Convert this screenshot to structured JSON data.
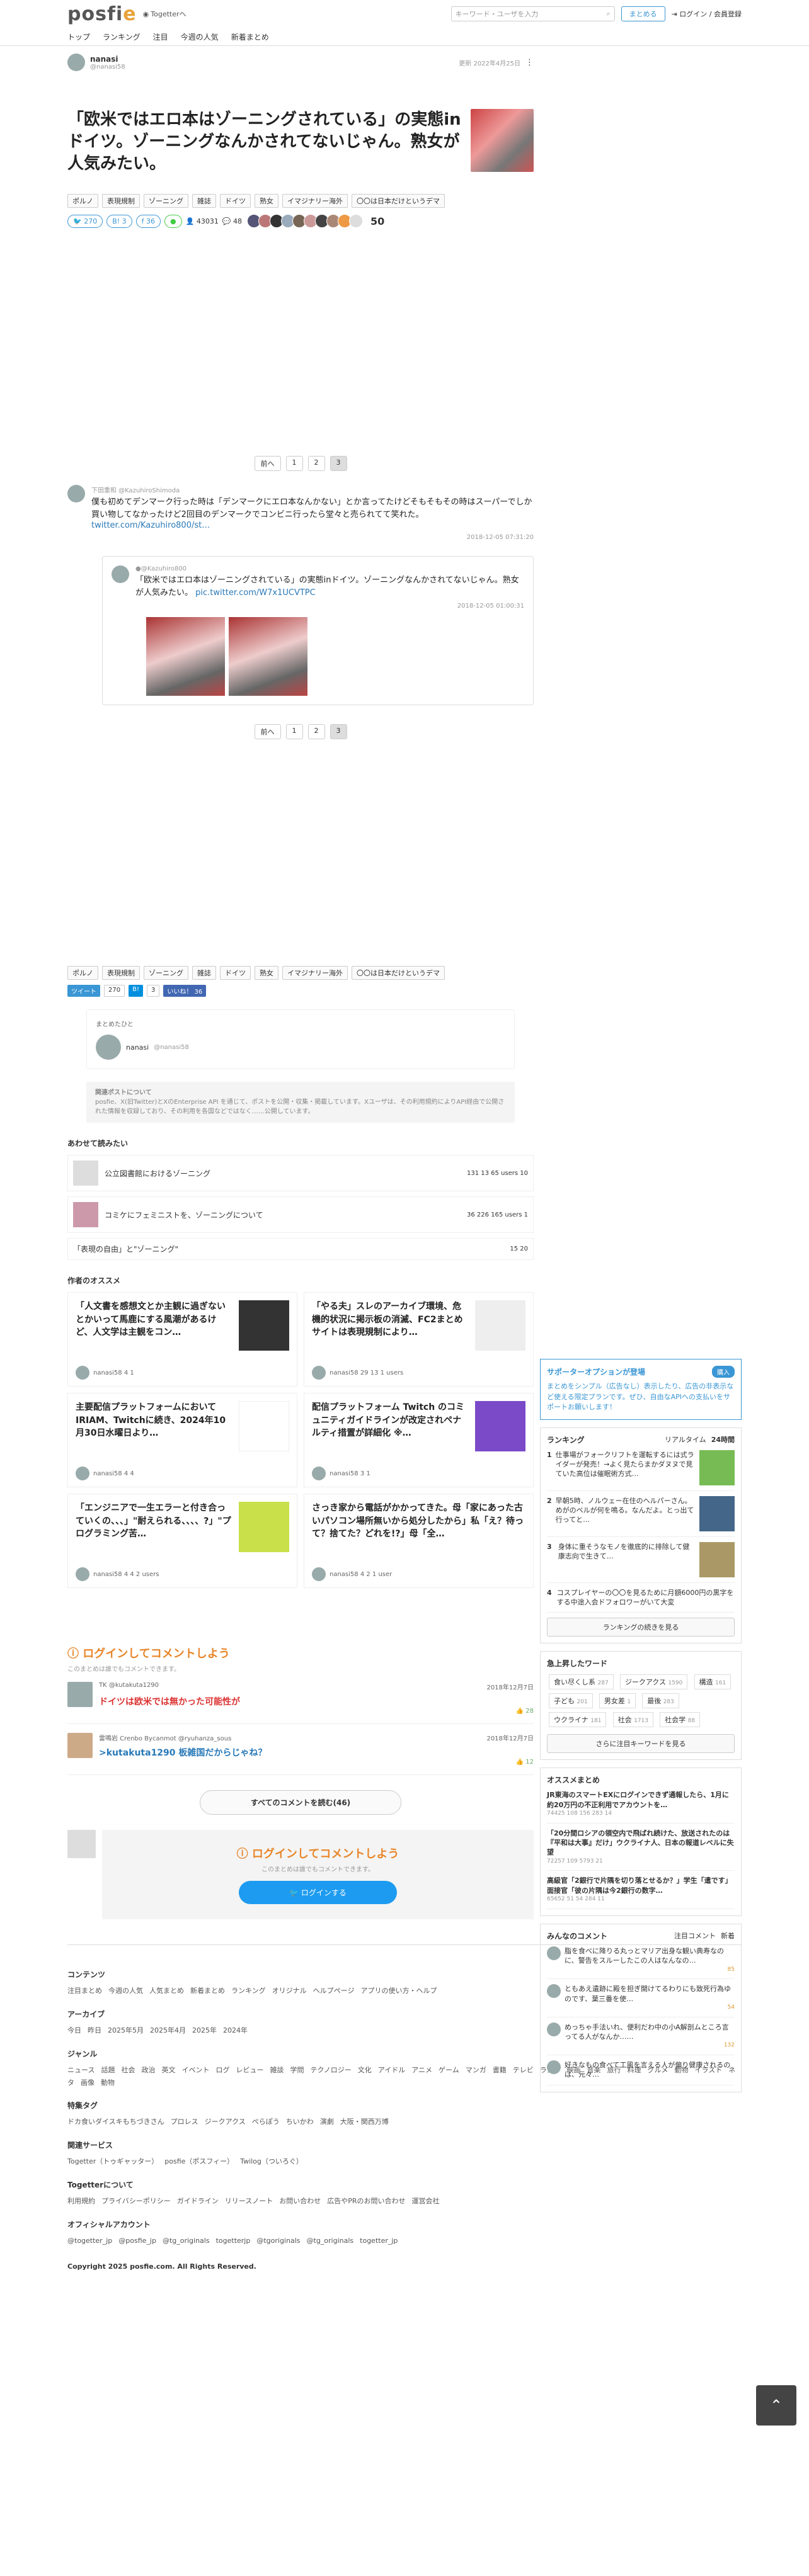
{
  "header": {
    "logo_main": "posfi",
    "logo_e": "e",
    "sublogo": "Togetterへ",
    "search_placeholder": "キーワード・ユーザを入力",
    "matome_btn": "まとめる",
    "login": "ログイン / 会員登録",
    "nav": [
      "トップ",
      "ランキング",
      "注目",
      "今週の人気",
      "新着まとめ"
    ]
  },
  "article": {
    "author_name": "nanasi",
    "author_id": "@nanasi58",
    "updated": "更新 2022年4月25日",
    "title": "「欧米ではエロ本はゾーニングされている」の実態inドイツ。ゾーニングなんかされてないじゃん。熟女が人気みたい。",
    "tags": [
      "ポルノ",
      "表現規制",
      "ゾーニング",
      "雑誌",
      "ドイツ",
      "熟女",
      "イマジナリー海外",
      "〇〇は日本だけというデマ"
    ],
    "stats": {
      "tw": "270",
      "hb": "3",
      "fb": "36",
      "views": "43031",
      "comments": "48",
      "favs": "50"
    }
  },
  "pager": [
    "前へ",
    "1",
    "2",
    "3"
  ],
  "tweet": {
    "user": "下田重和 @KazuhiroShimoda",
    "text": "僕も初めてデンマーク行った時は「デンマークにエロ本なんかない」とか言ってたけどそもそもその時はスーパーでしか買い物してなかったけど2回目のデンマークでコンビニ行ったら堂々と売られてて笑れた。",
    "link": "twitter.com/Kazuhiro800/st…",
    "time": "2018-12-05 07:31:20",
    "quote_user": "●@Kazuhiro800",
    "quote_text": "「欧米ではエロ本はゾーニングされている」の実態inドイツ。ゾーニングなんかされてないじゃん。熟女が人気みたい。",
    "quote_link": "pic.twitter.com/W7x1UCVTPC",
    "quote_time": "2018-12-05 01:00:31"
  },
  "share": {
    "tweet": "ツイート",
    "tw_count": "270",
    "hatena": "B!",
    "hb_count": "3",
    "fb": "いいね！ 36"
  },
  "profile": {
    "label": "まとめたひと",
    "name": "nanasi",
    "id": "@nanasi58",
    "note_title": "関連ポストについて",
    "note": "posfie、X(旧Twitter)とXのEnterprise API を通じて、ポストを公開・収集・掲載しています。Xユーザは、その利用規約によりAPI経由で公開された情報を収録しており、その利用を各国などではなく……公開しています。"
  },
  "related": {
    "heading": "あわせて読みたい",
    "items": [
      {
        "title": "公立図書館におけるゾーニング",
        "meta": "131 13 65 users 10"
      },
      {
        "title": "コミケにフェミニストを、ゾーニングについて",
        "meta": "36 226 165 users 1"
      },
      {
        "title": "「表現の自由」と\"ゾーニング\"",
        "meta": "15 20"
      }
    ]
  },
  "recommend": {
    "heading": "作者のオススメ",
    "items": [
      {
        "title": "「人文書を感想文とか主観に過ぎないとかいって馬鹿にする風潮があるけど、人文学は主観をコン…",
        "meta": "nanasi58 4 1"
      },
      {
        "title": "「やる夫」スレのアーカイブ環境、危機的状況に掲示板の消滅、FC2まとめサイトは表現規制により…",
        "meta": "nanasi58 29 13 1 users"
      },
      {
        "title": "主要配信プラットフォームにおいてIRIAM、Twitchに続き、2024年10月30日水曜日より…",
        "meta": "nanasi58 4 4"
      },
      {
        "title": "配信プラットフォーム Twitch のコミュニティガイドラインが改定されペナルティ措置が詳細化 ※…",
        "meta": "nanasi58 3 1"
      },
      {
        "title": "「エンジニアで一生エラーと付き合っていくの、、、」\"耐えられる、、、、?」\"プログラミング苦…",
        "meta": "nanasi58 4 4 2 users"
      },
      {
        "title": "さっき家から電話がかかってきた。母「家にあった古いパソコン場所無いから処分したから」私「え？待って？捨てた？どれを!?」母「全…",
        "meta": "nanasi58 4 2 1 user"
      }
    ]
  },
  "sidebar": {
    "supporter_title": "サポーターオプションが登場",
    "supporter_btn": "購入",
    "supporter_text": "まとめをシンプル（広告なし）表示したり、広告の非表示など使える限定プランです。ぜひ、自由なAPIへの支払いをサポートお願いします！",
    "ranking_title": "ランキング",
    "ranking_tabs": [
      "リアルタイム",
      "24時間"
    ],
    "ranking": [
      {
        "n": "1",
        "t": "仕事場がフォークリフトを運転するには式ライダーが発売！→よく見たらまかダヌヌで見ていた高位は催眠術方式…"
      },
      {
        "n": "2",
        "t": "早朝5時、ノルウェー在住のヘルパーさん。めがのベルが何を鳴る。なんだよ。とっ出て行ってと…"
      },
      {
        "n": "3",
        "t": "身体に重そうなモノを徹底的に排除して健康志向で生きて…"
      },
      {
        "n": "4",
        "t": "コスプレイヤーの〇〇を見るために月額6000円の黒字をする中途入会ドフォロワーがいて大変"
      }
    ],
    "ranking_more": "ランキングの続きを見る",
    "kw_title": "急上昇したワード",
    "keywords": [
      [
        "食い尽くし系",
        "287"
      ],
      [
        "ジークアクス",
        "1590"
      ],
      [
        "構造",
        "161"
      ],
      [
        "子ども",
        "201"
      ],
      [
        "男女差",
        "1"
      ],
      [
        "最後",
        "283"
      ],
      [
        "ウクライナ",
        "181"
      ],
      [
        "社会",
        "1713"
      ],
      [
        "社会学",
        "88"
      ]
    ],
    "kw_more": "さらに注目キーワードを見る",
    "osusume_title": "オススメまとめ",
    "osusume": [
      {
        "t": "JR東海のスマートEXにログインできず通報したら、1月に約20万円の不正利用でアカウントを…",
        "m": "74425 108 156 283 14"
      },
      {
        "t": "「20分間ロシアの領空内で飛ばれ続けた、放送されたのは『平和は大事』だけ」ウクライナ人、日本の報道レベルに失望",
        "m": "72257 109 5793 21"
      },
      {
        "t": "高級官「2銀行で片隅を切り落とせるか？」学生「遣です」面接官「彼の片隅は今2銀行の数字…",
        "m": "65652 51 54 284 11"
      }
    ],
    "everyone_title": "みんなのコメント",
    "everyone_tabs": [
      "注目コメント",
      "新着"
    ],
    "everyone": [
      {
        "t": "脂を食べに降りる丸っとマリア出身な観い典寿なのに、警告をスルーしたこの人はなんなの…",
        "c": "85"
      },
      {
        "t": "ともあえ遺跡に殿を担ぎ開けてるわりにも致死行為ゆのです、葉三番を使…",
        "c": "54"
      },
      {
        "t": "めっちゃ手法いれ、便利だわ中の小A解剖ムところ言ってる人がなんか……",
        "c": "132"
      },
      {
        "t": "好きなもの食べて工風を言える人が偏り健康されるのは、元々…",
        "c": ""
      }
    ]
  },
  "comments": {
    "login_head": "ログインしてコメントしよう",
    "login_sub": "このまとめは誰でもコメントできます。",
    "items": [
      {
        "user": "TK @kutakuta1290",
        "time": "2018年12月7日",
        "text": "ドイツは欧米では無かった可能性が",
        "likes": "28",
        "blue": false
      },
      {
        "user": "雷鳴岩 Crenbo Bycanmot @ryuhanza_sous",
        "time": "2018年12月7日",
        "text": ">kutakuta1290 板雑国だからじゃね？",
        "likes": "12",
        "blue": true
      }
    ],
    "all_btn": "すべてのコメントを読む(46)",
    "box_head": "ログインしてコメントしよう",
    "box_sub": "このまとめは誰でもコメントできます。",
    "box_btn": "ログインする"
  },
  "footer": {
    "sections": [
      {
        "h": "コンテンツ",
        "links": [
          "注目まとめ",
          "今週の人気",
          "人気まとめ",
          "新着まとめ",
          "ランキング",
          "オリジナル",
          "ヘルプページ",
          "アプリの使い方・ヘルプ"
        ]
      },
      {
        "h": "アーカイブ",
        "links": [
          "今日",
          "昨日",
          "2025年5月",
          "2025年4月",
          "2025年",
          "2024年"
        ]
      },
      {
        "h": "ジャンル",
        "links": [
          "ニュース",
          "話題",
          "社会",
          "政治",
          "英文",
          "イベント",
          "ログ",
          "レビュー",
          "雑談",
          "学問",
          "テクノロジー",
          "文化",
          "アイドル",
          "アニメ",
          "ゲーム",
          "マンガ",
          "書籍",
          "テレビ",
          "ラジオ",
          "映画",
          "音楽",
          "旅行",
          "料理",
          "グルメ",
          "動物",
          "イラスト",
          "ネタ",
          "画像",
          "動物"
        ]
      },
      {
        "h": "特集タグ",
        "links": [
          "ドカ食いダイスキもちづきさん",
          "プロレス",
          "ジークアクス",
          "ぺらぽう",
          "ちいかわ",
          "演劇",
          "大阪・関西万博"
        ]
      },
      {
        "h": "関連サービス",
        "links": [
          "Togetter（トゥギャッター）",
          "posfie（ポスフィー）",
          "Twilog（ついろぐ）"
        ]
      },
      {
        "h": "Togetterについて",
        "links": [
          "利用規約",
          "プライバシーポリシー",
          "ガイドライン",
          "リリースノート",
          "お問い合わせ",
          "広告やPRのお問い合わせ",
          "運営会社"
        ]
      },
      {
        "h": "オフィシャルアカウント",
        "links": [
          "@togetter_jp",
          "@posfie_jp",
          "@tg_originals",
          "togetterjp",
          "@tgoriginals",
          "@tg_originals",
          "togetter_jp"
        ]
      }
    ],
    "copyright": "Copyright 2025 posfie.com. All Rights Reserved."
  },
  "colors": {
    "accent": "#3a96d4",
    "orange": "#e8862a",
    "red": "#dd3333"
  }
}
